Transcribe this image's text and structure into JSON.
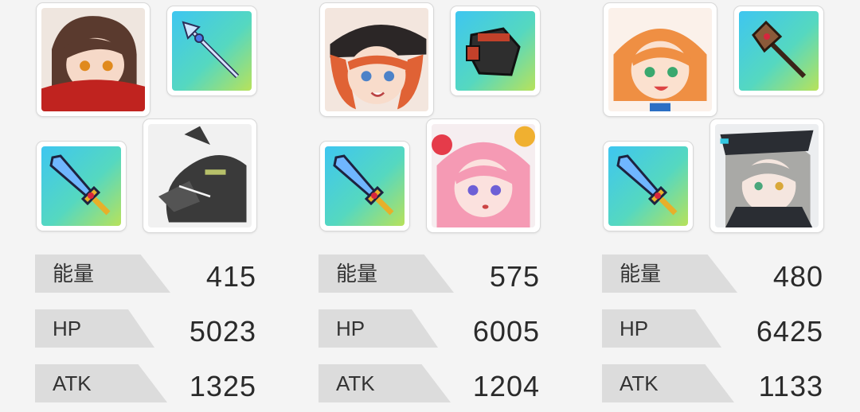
{
  "teams": [
    {
      "stats": [
        {
          "label": "能量",
          "value": "415"
        },
        {
          "label": "HP",
          "value": "5023"
        },
        {
          "label": "ATK",
          "value": "1325"
        }
      ]
    },
    {
      "stats": [
        {
          "label": "能量",
          "value": "575"
        },
        {
          "label": "HP",
          "value": "6005"
        },
        {
          "label": "ATK",
          "value": "1204"
        }
      ]
    },
    {
      "stats": [
        {
          "label": "能量",
          "value": "480"
        },
        {
          "label": "HP",
          "value": "6425"
        },
        {
          "label": "ATK",
          "value": "1133"
        }
      ]
    }
  ],
  "icons": {
    "portraits": [
      "brown-haired-girl-red-scarf-portrait",
      "black-dragon-portrait",
      "red-haired-witch-portrait",
      "pink-haired-girl-portrait",
      "orange-haired-girl-portrait",
      "silver-haired-girl-portrait"
    ],
    "weapons": [
      "spear-weapon-icon",
      "sword-weapon-icon",
      "gauntlet-weapon-icon",
      "sword-weapon-icon",
      "axe-weapon-icon",
      "sword-weapon-icon"
    ]
  },
  "colors": {
    "label_bg": "#dcdcdc",
    "weapon_gradient_a": "#3fd0e8",
    "weapon_gradient_b": "#b6e25a"
  }
}
